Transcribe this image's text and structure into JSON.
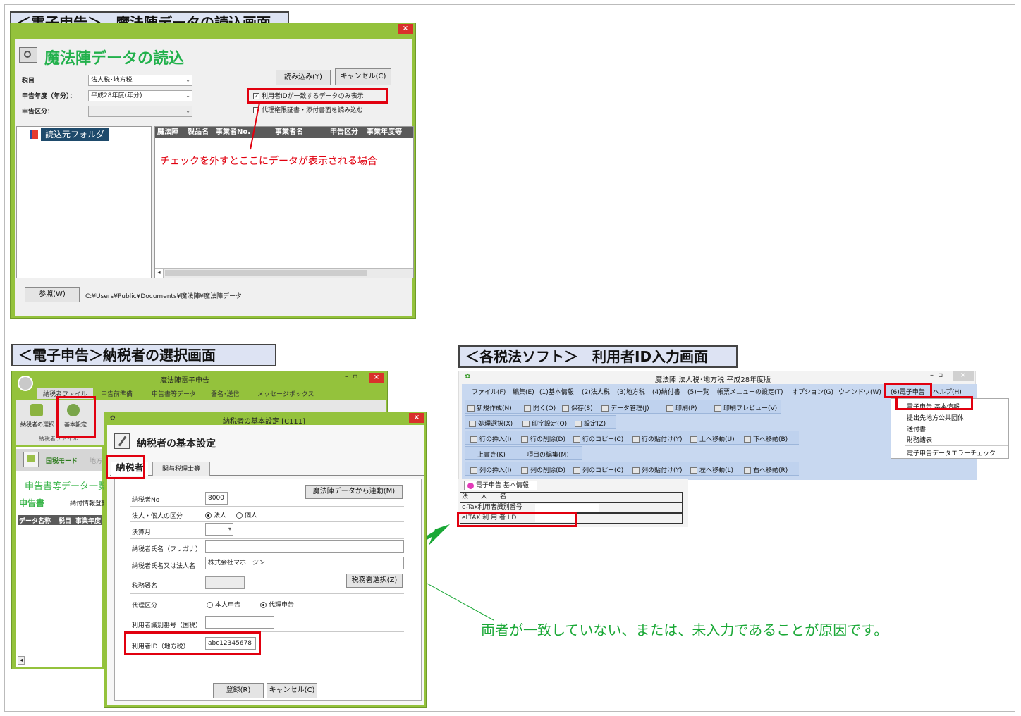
{
  "sec1": {
    "title": "＜電子申告＞　魔法陣データの読込画面",
    "heading": "魔法陣データの読込",
    "close": "×",
    "labels": {
      "tax": "税目",
      "year": "申告年度（年分）：",
      "kubun": "申告区分："
    },
    "tax_value": "法人税･地方税",
    "year_value": "平成28年度(年分)",
    "load_button": "読み込み(Y)",
    "cancel_button": "キャンセル(C)",
    "check1": "利用者IDが一致するデータのみ表示",
    "check2": "代理権限証書・添付書面を読み込む",
    "check_mark": "✓",
    "folder_label": "読込元フォルダ",
    "columns": [
      "魔法陣",
      "製品名",
      "事業者No.",
      "事業者名",
      "申告区分",
      "事業年度等"
    ],
    "annotation": "チェックを外すとここにデータが表示される場合",
    "browse_button": "参照(W)",
    "path": "C:¥Users¥Public¥Documents¥魔法陣¥魔法陣データ"
  },
  "sec2": {
    "title": "＜電子申告＞納税者の選択画面",
    "window_title": "魔法陣電子申告",
    "ribbon_tabs": [
      "納税者ファイル",
      "申告前準備",
      "申告書等データ",
      "署名･送信",
      "メッセージボックス"
    ],
    "ribbon_buttons": [
      "納税者の選択",
      "基本設定"
    ],
    "ribbon_group": "納税者ファイル",
    "mode_label": "国税モード",
    "mode2": "地方",
    "subheader": "申告書等データ一覧",
    "sub_tabs": [
      "申告書",
      "納付情報登録"
    ],
    "left_columns": [
      "データ名称",
      "税目",
      "事業年度"
    ],
    "dialog": {
      "window_title": "納税者の基本設定 [C111]",
      "heading": "納税者の基本設定",
      "tabs": [
        "納税者",
        "関与税理士等"
      ],
      "link_button": "魔法陣データから連動(M)",
      "fields": {
        "no_label": "納税者No",
        "no_value": "8000",
        "kubun_label": "法人・個人の区分",
        "radio_corp": "法人",
        "radio_ind": "個人",
        "month_label": "決算月",
        "kana_label": "納税者氏名（フリガナ）",
        "name_label": "納税者氏名又は法人名",
        "name_value": "株式会社マホージン",
        "office_label": "税務署名",
        "office_button": "税務署選択(Z)",
        "agent_label": "代理区分",
        "radio_self": "本人申告",
        "radio_agent": "代理申告",
        "taxid_label": "利用者識別番号（国税）",
        "localid_label": "利用者ID（地方税）",
        "localid_value": "abc12345678"
      },
      "ok_button": "登録(R)",
      "cancel_button": "キャンセル(C)"
    }
  },
  "sec3": {
    "title": "＜各税法ソフト＞　利用者ID入力画面",
    "window_title": "魔法陣 法人税･地方税 平成28年度版",
    "menu": [
      "ファイル(F)",
      "編集(E)",
      "(1)基本情報",
      "(2)法人税",
      "(3)地方税",
      "(4)納付書",
      "(5)一覧",
      "帳票メニューの設定(T)",
      "オプション(G)",
      "ウィンドウ(W)",
      "(6)電子申告",
      "ヘルプ(H)"
    ],
    "toolbar1": [
      "新規作成(N)",
      "開く(O)",
      "保存(S)",
      "データ管理(J)",
      "印刷(P)",
      "印刷プレビュー(V)"
    ],
    "toolbar2": [
      "処理選択(X)",
      "印字設定(Q)",
      "設定(Z)"
    ],
    "toolbar3": [
      "行の挿入(I)",
      "行の削除(D)",
      "行のコピー(C)",
      "行の貼付け(Y)",
      "上へ移動(U)",
      "下へ移動(B)"
    ],
    "toolbar4": [
      "上書き(K)",
      "項目の編集(M)"
    ],
    "toolbar5": [
      "列の挿入(I)",
      "列の削除(D)",
      "列のコピー(C)",
      "列の貼付け(Y)",
      "左へ移動(L)",
      "右へ移動(R)"
    ],
    "dropdown": [
      "電子申告 基本情報",
      "提出先地方公共団体",
      "送付書",
      "財務諸表",
      "電子申告データエラーチェック"
    ],
    "tab_label": "電子申告 基本情報",
    "rows": [
      "法　　人　　名",
      "e-Tax利用者識別番号",
      "eLTAX 利 用 者 I D"
    ]
  },
  "note": "両者が一致していない、または、未入力であることが原因です。",
  "colors": {
    "window_green": "#94c23c",
    "red": "#e1000f",
    "arrow_green": "#1aa836",
    "heading_green": "#22b14c"
  }
}
